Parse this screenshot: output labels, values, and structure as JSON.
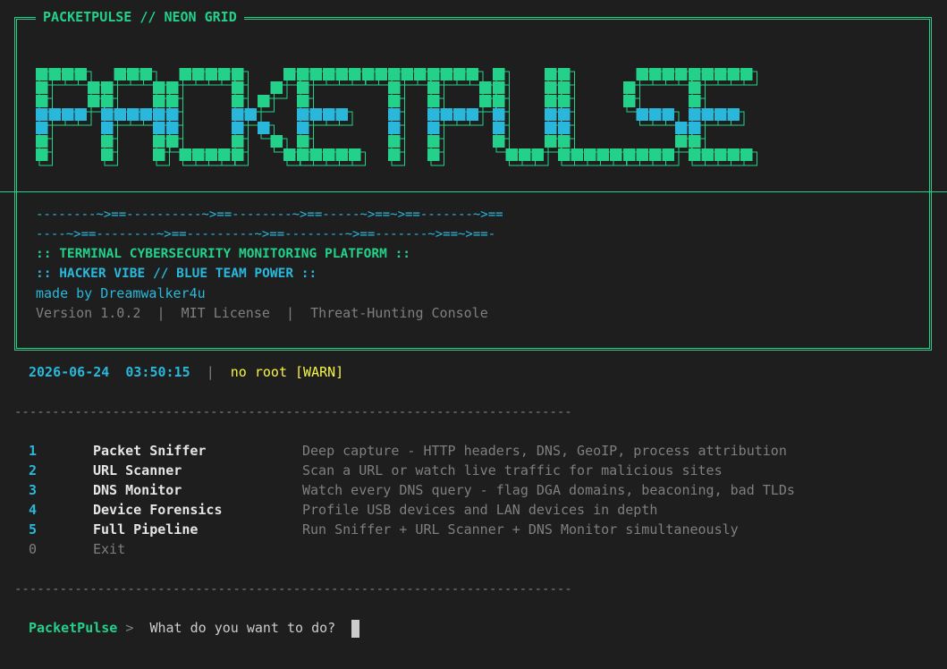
{
  "window": {
    "frame_title": "PACKETPULSE // NEON GRID"
  },
  "banner": {
    "logo_text": "PACKETPULSE",
    "pulse_line_1": "--------~>==----------~>==--------~>==-----~>==~>==-------~>==",
    "pulse_line_2": "----~>==--------~>==---------~>==--------~>==-------~>==~>==-",
    "tagline_1": ":: TERMINAL CYBERSECURITY MONITORING PLATFORM ::",
    "tagline_2": ":: HACKER VIBE // BLUE TEAM POWER ::",
    "author": "made by Dreamwalker4u",
    "version": "Version 1.0.2",
    "license": "MIT License",
    "console": "Threat-Hunting Console",
    "separator": "|"
  },
  "status": {
    "date": "2026-06-24",
    "time": "03:50:15",
    "separator": "|",
    "root_status": "no root",
    "warn_badge": "[WARN]"
  },
  "divider": "--------------------------------------------------------------------------",
  "menu": [
    {
      "key": "1",
      "label": "Packet Sniffer",
      "description": "Deep capture - HTTP headers, DNS, GeoIP, process attribution"
    },
    {
      "key": "2",
      "label": "URL Scanner",
      "description": "Scan a URL or watch live traffic for malicious sites"
    },
    {
      "key": "3",
      "label": "DNS Monitor",
      "description": "Watch every DNS query - flag DGA domains, beaconing, bad TLDs"
    },
    {
      "key": "4",
      "label": "Device Forensics",
      "description": "Profile USB devices and LAN devices in depth"
    },
    {
      "key": "5",
      "label": "Full Pipeline",
      "description": "Run Sniffer + URL Scanner + DNS Monitor simultaneously"
    },
    {
      "key": "0",
      "label": "Exit",
      "description": ""
    }
  ],
  "prompt": {
    "app_name": "PacketPulse",
    "arrow": ">",
    "question": "What do you want to do?"
  },
  "colors": {
    "green": "#23d18b",
    "blue": "#29b8db",
    "yellow": "#f5f543",
    "background": "#1e1e1e"
  }
}
